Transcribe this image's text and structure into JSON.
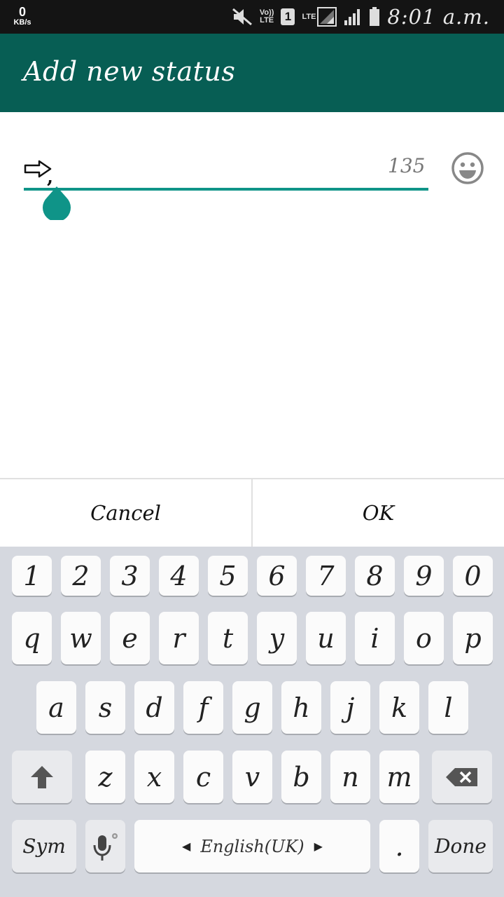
{
  "status_bar": {
    "net_speed": "0",
    "net_speed_unit": "KB/s",
    "volte_label": "Vo))\nLTE",
    "sim_slot": "1",
    "lte_label": "LTE",
    "time": "8:01 a.m.",
    "icons": [
      "mute-icon",
      "volte-icon",
      "sim-icon",
      "lte-signal-icon",
      "signal-icon",
      "battery-icon"
    ]
  },
  "app_bar": {
    "title": "Add new status"
  },
  "status_input": {
    "value": "⇨,",
    "remaining_chars": "135",
    "accent_color": "#0f9488"
  },
  "dialog": {
    "cancel_label": "Cancel",
    "ok_label": "OK"
  },
  "keyboard": {
    "row_numbers": [
      "1",
      "2",
      "3",
      "4",
      "5",
      "6",
      "7",
      "8",
      "9",
      "0"
    ],
    "row_top": [
      "q",
      "w",
      "e",
      "r",
      "t",
      "y",
      "u",
      "i",
      "o",
      "p"
    ],
    "row_home": [
      "a",
      "s",
      "d",
      "f",
      "g",
      "h",
      "j",
      "k",
      "l"
    ],
    "row_bottom": [
      "z",
      "x",
      "c",
      "v",
      "b",
      "n",
      "m"
    ],
    "sym_label": "Sym",
    "language_label": "English(UK)",
    "period_label": ".",
    "done_label": "Done"
  },
  "colors": {
    "app_bar": "#075e54",
    "status_bar": "#141414",
    "keyboard_bg": "#d5d8df"
  }
}
